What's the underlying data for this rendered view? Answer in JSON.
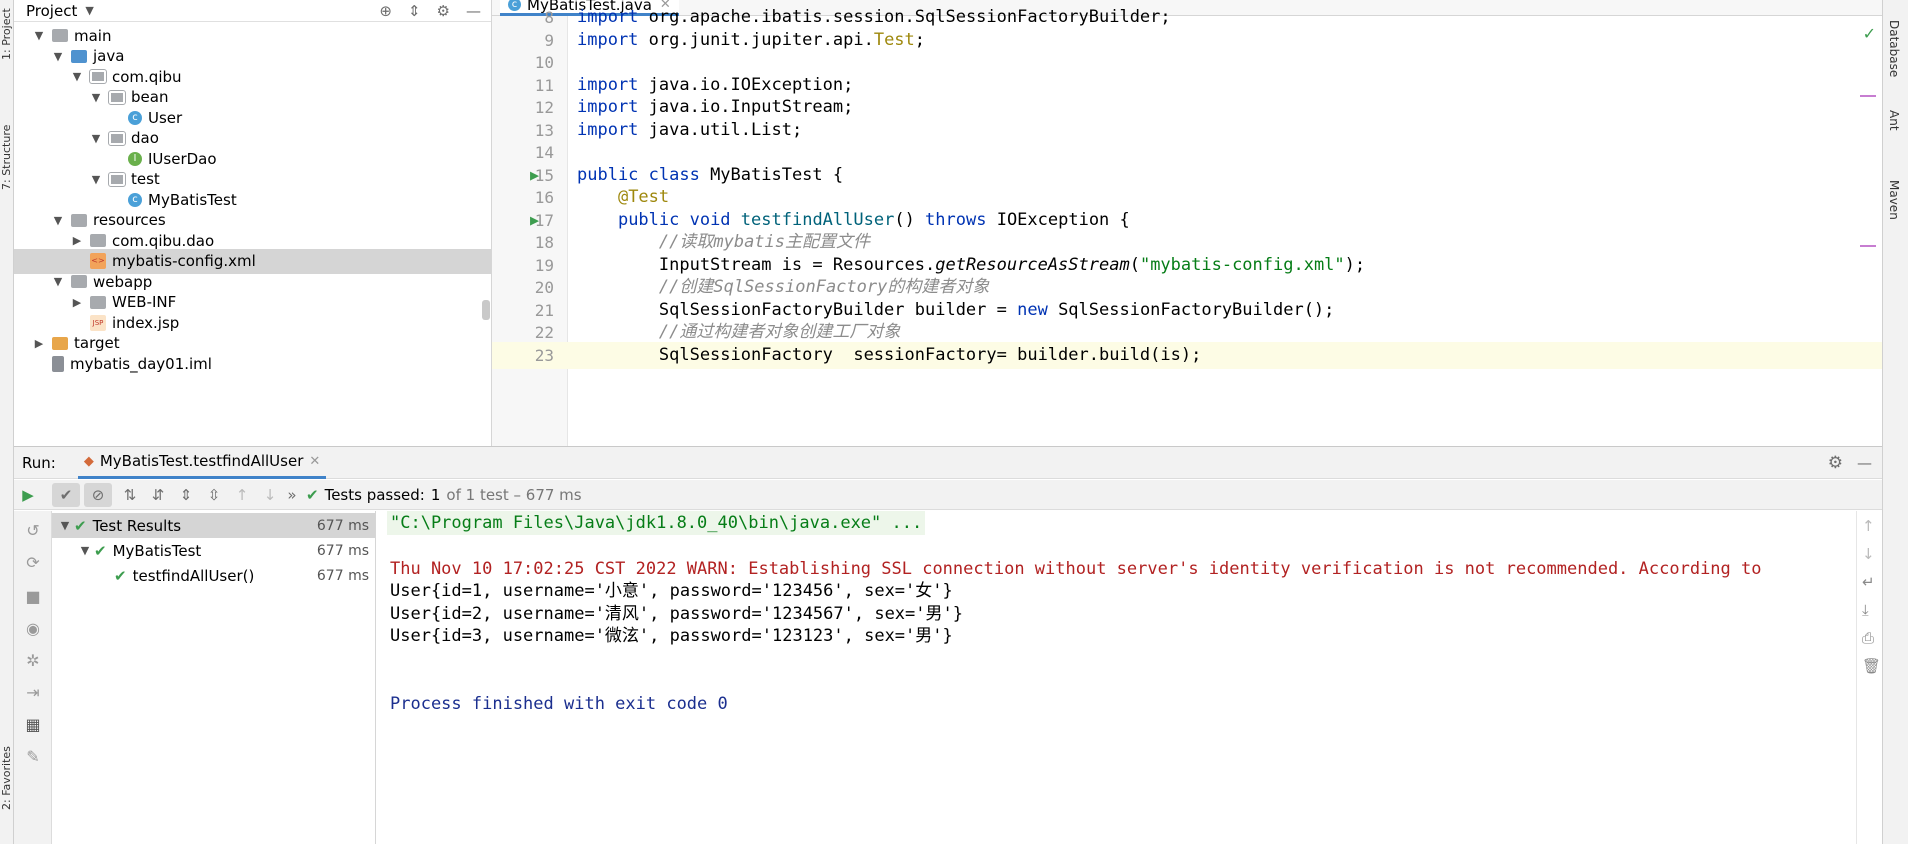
{
  "left_strip": {
    "project_tab": "1: Project",
    "structure_tab": "7: Structure",
    "favorites_tab": "2: Favorites"
  },
  "right_strip": {
    "database": "Database",
    "ant": "Ant",
    "maven": "Maven"
  },
  "project_panel": {
    "title": "Project",
    "tree": [
      {
        "label": "main",
        "icon": "folder",
        "arrow": "▼",
        "indent": 1
      },
      {
        "label": "java",
        "icon": "folder-blue",
        "arrow": "▼",
        "indent": 2
      },
      {
        "label": "com.qibu",
        "icon": "package",
        "arrow": "▼",
        "indent": 3
      },
      {
        "label": "bean",
        "icon": "package",
        "arrow": "▼",
        "indent": 4
      },
      {
        "label": "User",
        "icon": "class",
        "arrow": "",
        "indent": 5
      },
      {
        "label": "dao",
        "icon": "package",
        "arrow": "▼",
        "indent": 4
      },
      {
        "label": "IUserDao",
        "icon": "interface",
        "arrow": "",
        "indent": 5
      },
      {
        "label": "test",
        "icon": "package",
        "arrow": "▼",
        "indent": 4
      },
      {
        "label": "MyBatisTest",
        "icon": "class",
        "arrow": "",
        "indent": 5
      },
      {
        "label": "resources",
        "icon": "folder",
        "arrow": "▼",
        "indent": 2
      },
      {
        "label": "com.qibu.dao",
        "icon": "folder",
        "arrow": "▶",
        "indent": 3
      },
      {
        "label": "mybatis-config.xml",
        "icon": "xml",
        "arrow": "",
        "indent": 3,
        "selected": true
      },
      {
        "label": "webapp",
        "icon": "folder",
        "arrow": "▼",
        "indent": 2
      },
      {
        "label": "WEB-INF",
        "icon": "folder",
        "arrow": "▶",
        "indent": 3
      },
      {
        "label": "index.jsp",
        "icon": "jsp",
        "arrow": "",
        "indent": 3
      },
      {
        "label": "target",
        "icon": "folder-orange",
        "arrow": "▶",
        "indent": 1
      },
      {
        "label": "mybatis_day01.iml",
        "icon": "iml",
        "arrow": "",
        "indent": 1
      }
    ]
  },
  "editor": {
    "tab_label": "MyBatisTest.java",
    "lines": [
      {
        "num": "8",
        "html": "<span class='kw'>import</span> org.apache.ibatis.session.SqlSessionFactoryBuilder;"
      },
      {
        "num": "9",
        "html": "<span class='kw'>import</span> org.junit.jupiter.api.<span class='ann'>Test</span>;"
      },
      {
        "num": "10",
        "html": ""
      },
      {
        "num": "11",
        "html": "<span class='kw'>import</span> java.io.IOException;"
      },
      {
        "num": "12",
        "html": "<span class='kw'>import</span> java.io.InputStream;"
      },
      {
        "num": "13",
        "html": "<span class='kw'>import</span> java.util.List;"
      },
      {
        "num": "14",
        "html": ""
      },
      {
        "num": "15",
        "html": "<span class='kw'>public class</span> MyBatisTest {",
        "run": true
      },
      {
        "num": "16",
        "html": "    <span class='ann'>@Test</span>"
      },
      {
        "num": "17",
        "html": "    <span class='kw'>public void</span> <span class='meth'>testfindAllUser</span>() <span class='kw'>throws</span> IOException {",
        "run": true
      },
      {
        "num": "18",
        "html": "        <span class='cmt'>//读取mybatis主配置文件</span>"
      },
      {
        "num": "19",
        "html": "        InputStream is = Resources.<span class='stat'>getResourceAsStream</span>(<span class='str'>\"mybatis-config.xml\"</span>);"
      },
      {
        "num": "20",
        "html": "        <span class='cmt'>//创建SqlSessionFactory的构建者对象</span>"
      },
      {
        "num": "21",
        "html": "        SqlSessionFactoryBuilder builder = <span class='kw'>new</span> SqlSessionFactoryBuilder();"
      },
      {
        "num": "22",
        "html": "        <span class='cmt'>//通过构建者对象创建工厂对象</span>"
      },
      {
        "num": "23",
        "html": "        SqlSessionFactory  sessionFactory= builder.build(is);",
        "current": true
      }
    ]
  },
  "run_panel": {
    "label": "Run:",
    "tab_label": "MyBatisTest.testfindAllUser",
    "tests_passed_label": "Tests passed:",
    "tests_passed_count": "1",
    "tests_passed_rest": "of 1 test – 677 ms",
    "results": [
      {
        "label": "Test Results",
        "time": "677 ms",
        "indent": 0,
        "arrow": "▼",
        "selected": true
      },
      {
        "label": "MyBatisTest",
        "time": "677 ms",
        "indent": 1,
        "arrow": "▼"
      },
      {
        "label": "testfindAllUser()",
        "time": "677 ms",
        "indent": 2,
        "arrow": ""
      }
    ],
    "console": {
      "cmd": "\"C:\\Program Files\\Java\\jdk1.8.0_40\\bin\\java.exe\" ...",
      "warn": "Thu Nov 10 17:02:25 CST 2022 WARN: Establishing SSL connection without server's identity verification is not recommended. According to",
      "users": [
        "User{id=1, username='小意', password='123456', sex='女'}",
        "User{id=2, username='清风', password='1234567', sex='男'}",
        "User{id=3, username='微泫', password='123123', sex='男'}"
      ],
      "exit": "Process finished with exit code 0"
    }
  }
}
